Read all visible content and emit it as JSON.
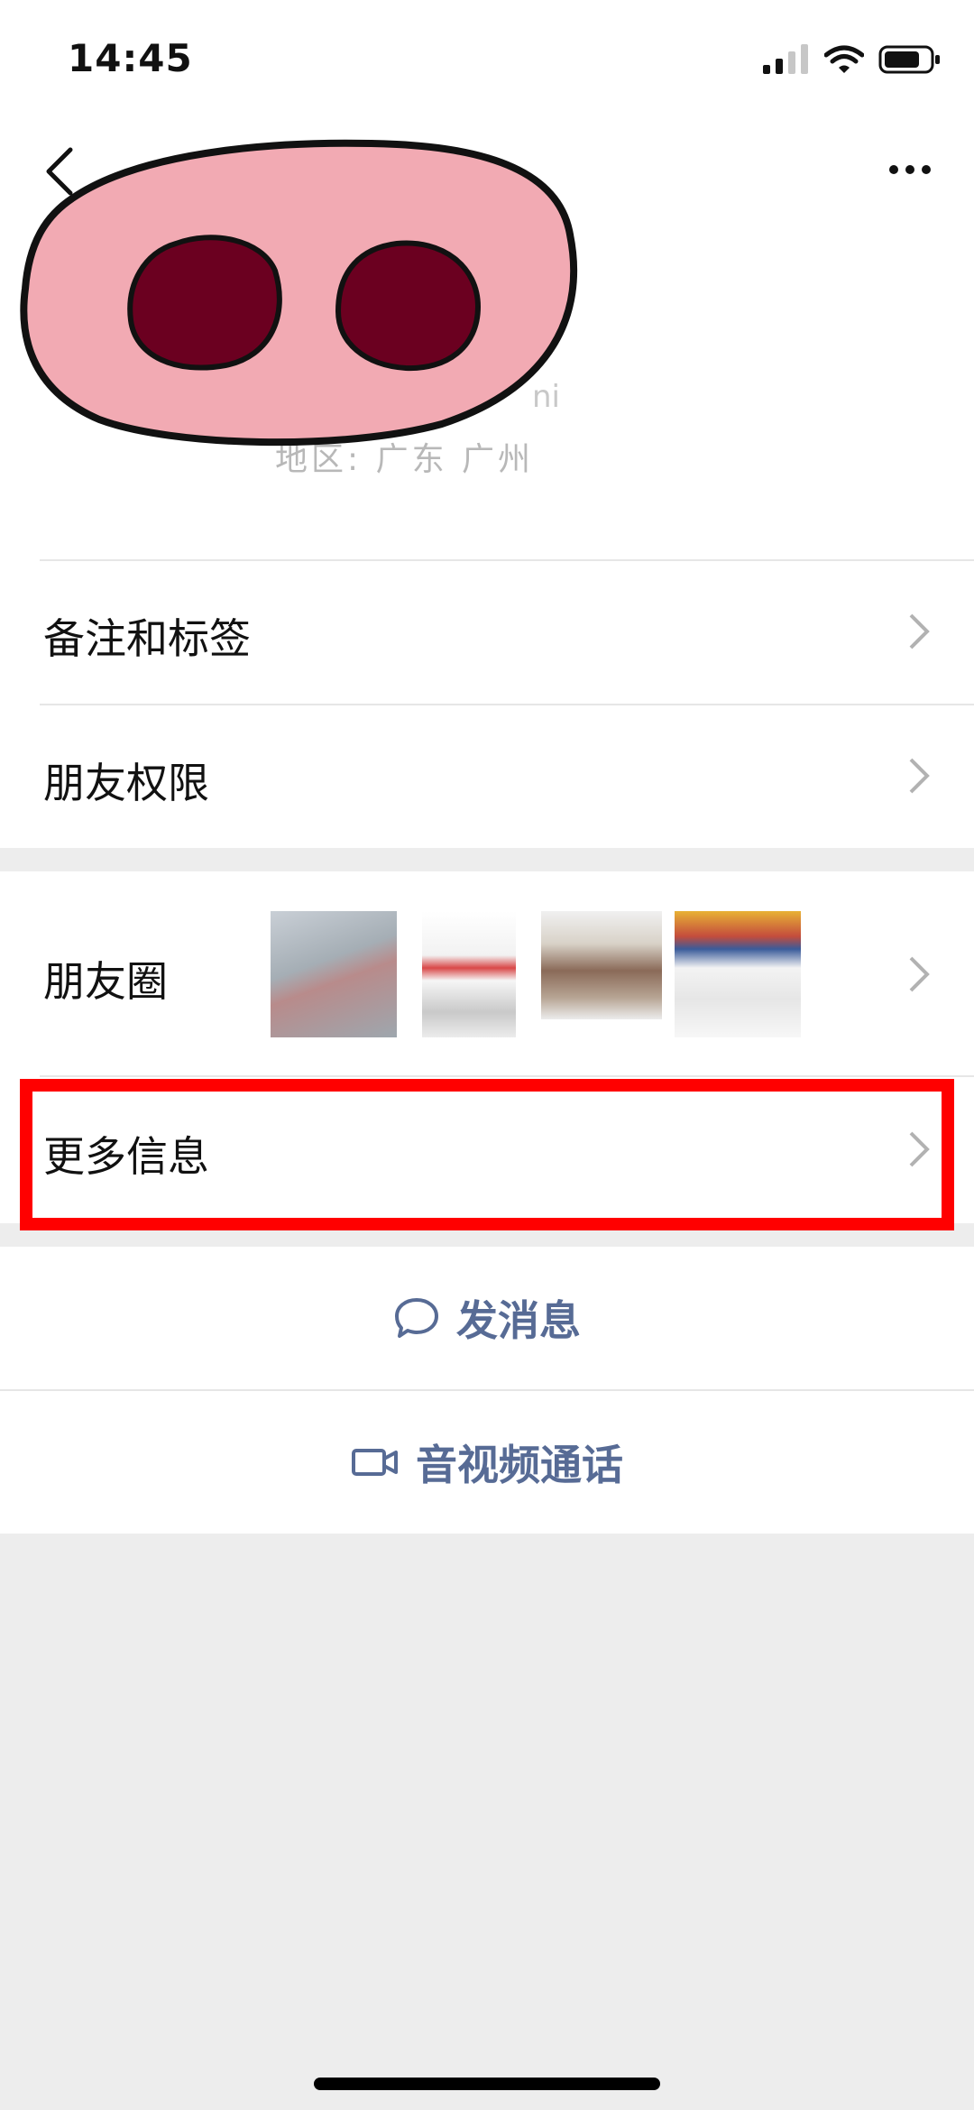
{
  "status_bar": {
    "time": "14:45",
    "icons": [
      "signal-icon",
      "wifi-icon",
      "battery-icon"
    ]
  },
  "header": {
    "back_icon": "back-chevron-icon",
    "more_icon": "more-dots-icon",
    "avatar": "pig-nose-sticker",
    "region_text": "地区: 广东 广州",
    "id_fragment": "ni"
  },
  "rows": {
    "notes_tags": "备注和标签",
    "friend_permissions": "朋友权限",
    "moments": "朋友圈",
    "more_info": "更多信息"
  },
  "actions": {
    "send_message": "发消息",
    "video_call": "音视频通话"
  },
  "colors": {
    "accent": "#576b95",
    "highlight": "#ff0000",
    "background": "#ededed"
  }
}
